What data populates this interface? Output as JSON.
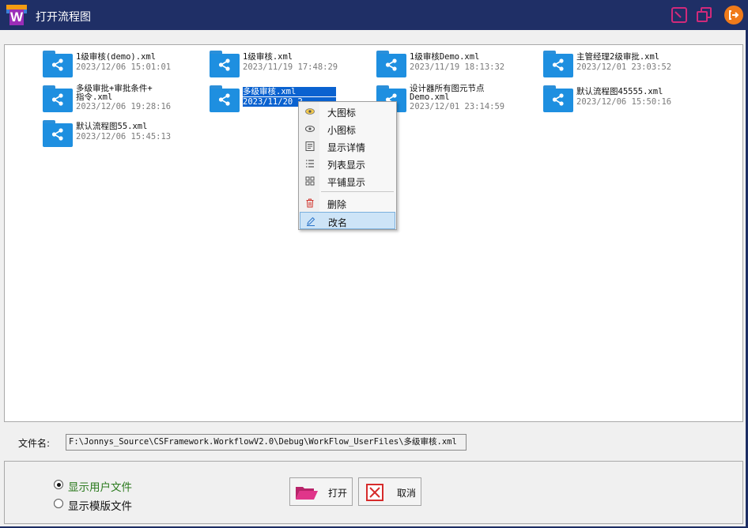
{
  "window": {
    "title": "打开流程图",
    "logo_letter": "W"
  },
  "title_buttons": [
    {
      "name": "restore-icon"
    },
    {
      "name": "maximize-icon"
    },
    {
      "name": "exit-icon"
    }
  ],
  "files": [
    {
      "name": "1级审核(demo).xml",
      "date": "2023/12/06 15:01:01",
      "selected": false
    },
    {
      "name": "1级审核.xml",
      "date": "2023/11/19 17:48:29",
      "selected": false
    },
    {
      "name": "1级审核Demo.xml",
      "date": "2023/11/19 18:13:32",
      "selected": false
    },
    {
      "name": "主管经理2级审批.xml",
      "date": "2023/12/01 23:03:52",
      "selected": false
    },
    {
      "name": "多级审批+审批条件+",
      "name2": "指令.xml",
      "date": "2023/12/06 19:28:16",
      "selected": false
    },
    {
      "name": "多级审核.xml",
      "date": "2023/11/20 2",
      "selected": true
    },
    {
      "name": "设计器所有图元节点",
      "name2": "Demo.xml",
      "date": "2023/12/01 23:14:59",
      "selected": false
    },
    {
      "name": "默认流程图45555.xml",
      "date": "2023/12/06 15:50:16",
      "selected": false
    },
    {
      "name": "默认流程图55.xml",
      "date": "2023/12/06 15:45:13",
      "selected": false
    }
  ],
  "context_menu": {
    "items": [
      {
        "label": "大图标",
        "icon": "large-icon-view-icon"
      },
      {
        "label": "小图标",
        "icon": "small-icon-view-icon"
      },
      {
        "label": "显示详情",
        "icon": "details-view-icon"
      },
      {
        "label": "列表显示",
        "icon": "list-view-icon"
      },
      {
        "label": "平铺显示",
        "icon": "tile-view-icon"
      },
      {
        "label": "删除",
        "icon": "trash-icon"
      },
      {
        "label": "改名",
        "icon": "rename-pencil-icon"
      }
    ]
  },
  "filename": {
    "label": "文件名:",
    "value": "F:\\Jonnys_Source\\CSFramework.WorkflowV2.0\\Debug\\WorkFlow_UserFiles\\多级审核.xml"
  },
  "options": {
    "show_user_files": "显示用户文件",
    "show_template_files": "显示模版文件",
    "selected": "show_user_files"
  },
  "buttons": {
    "open": "打开",
    "cancel": "取消"
  },
  "colors": {
    "titlebar": "#1f2f66",
    "selection": "#0a62d0",
    "folder_blue": "#1e8fe0",
    "accent_pink": "#d12a7a",
    "exit_orange": "#f07a1a",
    "radio_text_green": "#2b7a1e"
  }
}
